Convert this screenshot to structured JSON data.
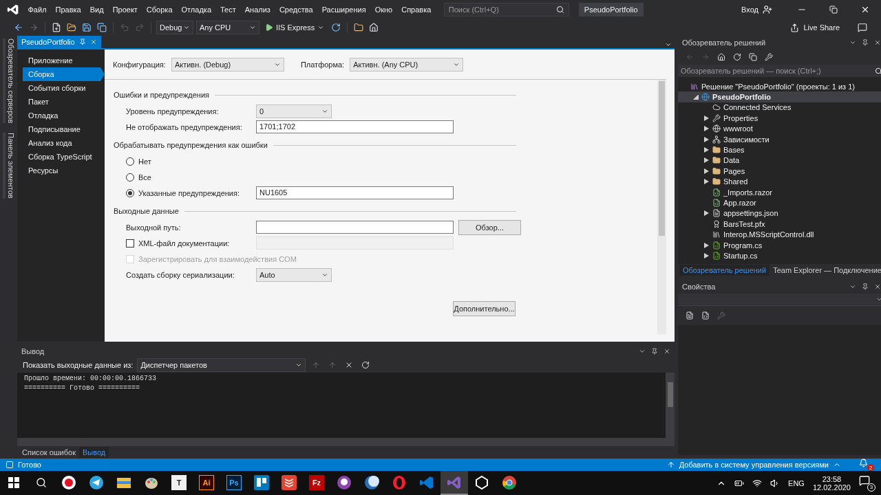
{
  "menu": [
    "Файл",
    "Правка",
    "Вид",
    "Проект",
    "Сборка",
    "Отладка",
    "Тест",
    "Анализ",
    "Средства",
    "Расширения",
    "Окно",
    "Справка"
  ],
  "search": {
    "placeholder": "Поиск (Ctrl+Q)"
  },
  "window": {
    "title": "PseudoPortfolio",
    "sign_in": "Вход"
  },
  "toolbar": {
    "configuration": "Debug",
    "platform": "Any CPU",
    "run": "IIS Express",
    "live_share": "Live Share"
  },
  "side_strip": [
    "Обозреватель серверов",
    "Панель элементов"
  ],
  "document_tab": {
    "label": "PseudoPortfolio",
    "selected": true
  },
  "nav": [
    {
      "label": "Приложение",
      "selected": false
    },
    {
      "label": "Сборка",
      "selected": true
    },
    {
      "label": "События сборки",
      "selected": false
    },
    {
      "label": "Пакет",
      "selected": false
    },
    {
      "label": "Отладка",
      "selected": false
    },
    {
      "label": "Подписывание",
      "selected": false
    },
    {
      "label": "Анализ кода",
      "selected": false
    },
    {
      "label": "Сборка TypeScript",
      "selected": false
    },
    {
      "label": "Ресурсы",
      "selected": false
    }
  ],
  "form": {
    "configuration": {
      "label": "Конфигурация:",
      "value": "Активн. (Debug)"
    },
    "platform": {
      "label": "Платформа:",
      "value": "Активн. (Any CPU)"
    },
    "sections": [
      {
        "title": "Ошибки и предупреждения",
        "rows": [
          {
            "kind": "select",
            "label": "Уровень предупреждения:",
            "value": "0"
          },
          {
            "kind": "input",
            "label": "Не отображать предупреждения:",
            "value": "1701;1702"
          }
        ]
      },
      {
        "title": "Обрабатывать предупреждения как ошибки",
        "rows": [
          {
            "kind": "radio",
            "label": "Нет",
            "selected": false
          },
          {
            "kind": "radio",
            "label": "Все",
            "selected": false
          },
          {
            "kind": "radio",
            "label": "Указанные предупреждения:",
            "selected": true,
            "value": "NU1605"
          }
        ]
      },
      {
        "title": "Выходные данные",
        "rows": [
          {
            "kind": "input",
            "label": "Выходной путь:",
            "button": "Обзор..."
          },
          {
            "kind": "checkbox",
            "label": "XML-файл документации:",
            "checked": false,
            "disabled": false,
            "field_disabled": true
          },
          {
            "kind": "checkbox",
            "label": "Зарегистрировать для взаимодействия COM",
            "checked": false,
            "disabled": true
          },
          {
            "kind": "select",
            "label": "Создать сборку сериализации:",
            "value": "Auto"
          }
        ]
      }
    ],
    "advanced_button": "Дополнительно..."
  },
  "output": {
    "title": "Вывод",
    "source_label": "Показать выходные данные из:",
    "source": "Диспетчер пакетов",
    "lines": [
      "Прошло времени: 00:00:00.1866733",
      "========== Готово =========="
    ],
    "tabs": [
      {
        "label": "Список ошибок",
        "selected": false
      },
      {
        "label": "Вывод",
        "selected": true
      }
    ]
  },
  "solution_explorer": {
    "title": "Обозреватель решений",
    "search_placeholder": "Обозреватель решений — поиск (Ctrl+;)",
    "tree": [
      {
        "label": "Решение \"PseudoPortfolio\" (проекты: 1 из 1)",
        "kind": "solution",
        "selected": false,
        "children": [
          {
            "label": "PseudoPortfolio",
            "kind": "project",
            "selected": true,
            "expanded": true,
            "children": [
              {
                "label": "Connected Services",
                "kind": "cloud",
                "selected": false
              },
              {
                "label": "Properties",
                "kind": "wrench",
                "selected": false,
                "expanded": false
              },
              {
                "label": "wwwroot",
                "kind": "globe",
                "selected": false,
                "expanded": false
              },
              {
                "label": "Зависимости",
                "kind": "deps",
                "selected": false,
                "expanded": false
              },
              {
                "label": "Bases",
                "kind": "folder",
                "selected": false,
                "expanded": false
              },
              {
                "label": "Data",
                "kind": "folder",
                "selected": false,
                "expanded": false
              },
              {
                "label": "Pages",
                "kind": "folder",
                "selected": false,
                "expanded": false
              },
              {
                "label": "Shared",
                "kind": "folder",
                "selected": false,
                "expanded": false
              },
              {
                "label": "_Imports.razor",
                "kind": "razor",
                "selected": false
              },
              {
                "label": "App.razor",
                "kind": "razor",
                "selected": false
              },
              {
                "label": "appsettings.json",
                "kind": "json",
                "selected": false,
                "expanded": false
              },
              {
                "label": "BarsTest.pfx",
                "kind": "cert",
                "selected": false
              },
              {
                "label": "Interop.MSScriptControl.dll",
                "kind": "dll",
                "selected": false
              },
              {
                "label": "Program.cs",
                "kind": "cs",
                "selected": false,
                "expanded": false
              },
              {
                "label": "Startup.cs",
                "kind": "cs",
                "selected": false,
                "expanded": false
              }
            ]
          }
        ]
      }
    ],
    "tabs": [
      {
        "label": "Обозреватель решений",
        "selected": true
      },
      {
        "label": "Team Explorer — Подключение",
        "selected": false
      }
    ]
  },
  "properties": {
    "title": "Свойства"
  },
  "status_bar": {
    "text": "Готово",
    "source_control": "Добавить в систему управления версиями",
    "notifications": "2"
  },
  "taskbar": {
    "apps": [
      {
        "kind": "record",
        "selected": false
      },
      {
        "kind": "telegram",
        "selected": false
      },
      {
        "kind": "explorer",
        "selected": false
      },
      {
        "kind": "paint",
        "selected": false
      },
      {
        "kind": "tile",
        "glyph": "T",
        "selected": false
      },
      {
        "kind": "illustrator",
        "glyph": "Ai",
        "selected": false
      },
      {
        "kind": "photoshop",
        "glyph": "Ps",
        "selected": false
      },
      {
        "kind": "trello",
        "selected": false
      },
      {
        "kind": "todoist",
        "selected": false
      },
      {
        "kind": "filezilla",
        "glyph": "Fz",
        "selected": false
      },
      {
        "kind": "github",
        "selected": false
      },
      {
        "kind": "moon",
        "selected": false
      },
      {
        "kind": "opera",
        "selected": false
      },
      {
        "kind": "vscode",
        "selected": false
      },
      {
        "kind": "visualstudio",
        "selected": true
      },
      {
        "kind": "unity",
        "selected": false
      },
      {
        "kind": "chrome",
        "selected": false
      }
    ],
    "language": "ENG",
    "time": "23:58",
    "date": "12.02.2020",
    "notifications": "3"
  }
}
